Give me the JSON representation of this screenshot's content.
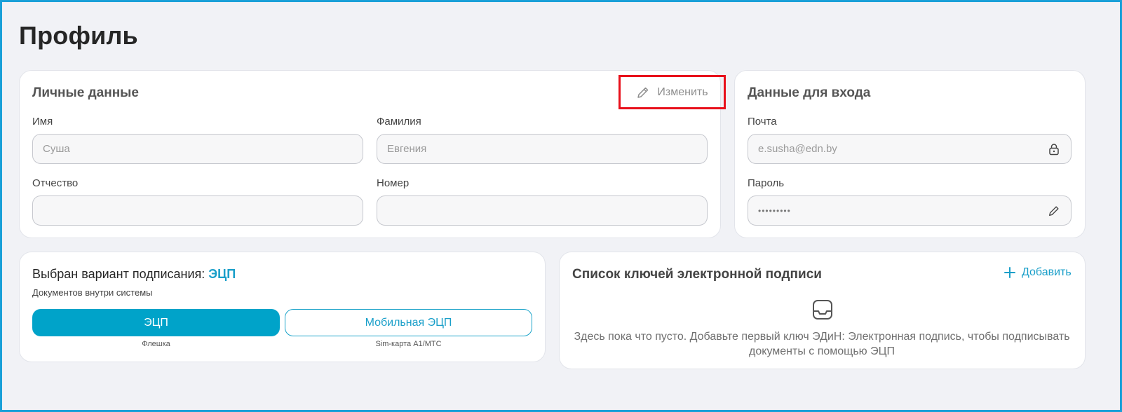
{
  "page": {
    "title": "Профиль"
  },
  "personal": {
    "title": "Личные данные",
    "edit_label": "Изменить",
    "fields": [
      {
        "label": "Имя",
        "value": "Суша"
      },
      {
        "label": "Фамилия",
        "value": "Евгения"
      },
      {
        "label": "Отчество",
        "value": ""
      },
      {
        "label": "Номер",
        "value": ""
      }
    ]
  },
  "login": {
    "title": "Данные для входа",
    "email": {
      "label": "Почта",
      "value": "e.susha@edn.by"
    },
    "password": {
      "label": "Пароль",
      "value": "•••••••••"
    }
  },
  "signing": {
    "title_prefix": "Выбран вариант подписания:",
    "title_value": "ЭЦП",
    "subtitle": "Документов внутри системы",
    "options": [
      {
        "label": "ЭЦП",
        "caption": "Флешка",
        "selected": true
      },
      {
        "label": "Мобильная ЭЦП",
        "caption": "Sim-карта А1/МТС",
        "selected": false
      }
    ]
  },
  "keys": {
    "title": "Список ключей электронной подписи",
    "add_label": "Добавить",
    "empty_line1": "Здесь пока что пусто. Добавьте первый ключ ЭДиН: Электронная подпись, чтобы подписывать",
    "empty_line2": "документы с помощью ЭЦП"
  },
  "colors": {
    "accent": "#00a3c9",
    "highlight": "#e8101b",
    "background": "#f1f2f6"
  },
  "icons": [
    "pencil-icon",
    "lock-icon",
    "plus-icon",
    "inbox-icon"
  ]
}
